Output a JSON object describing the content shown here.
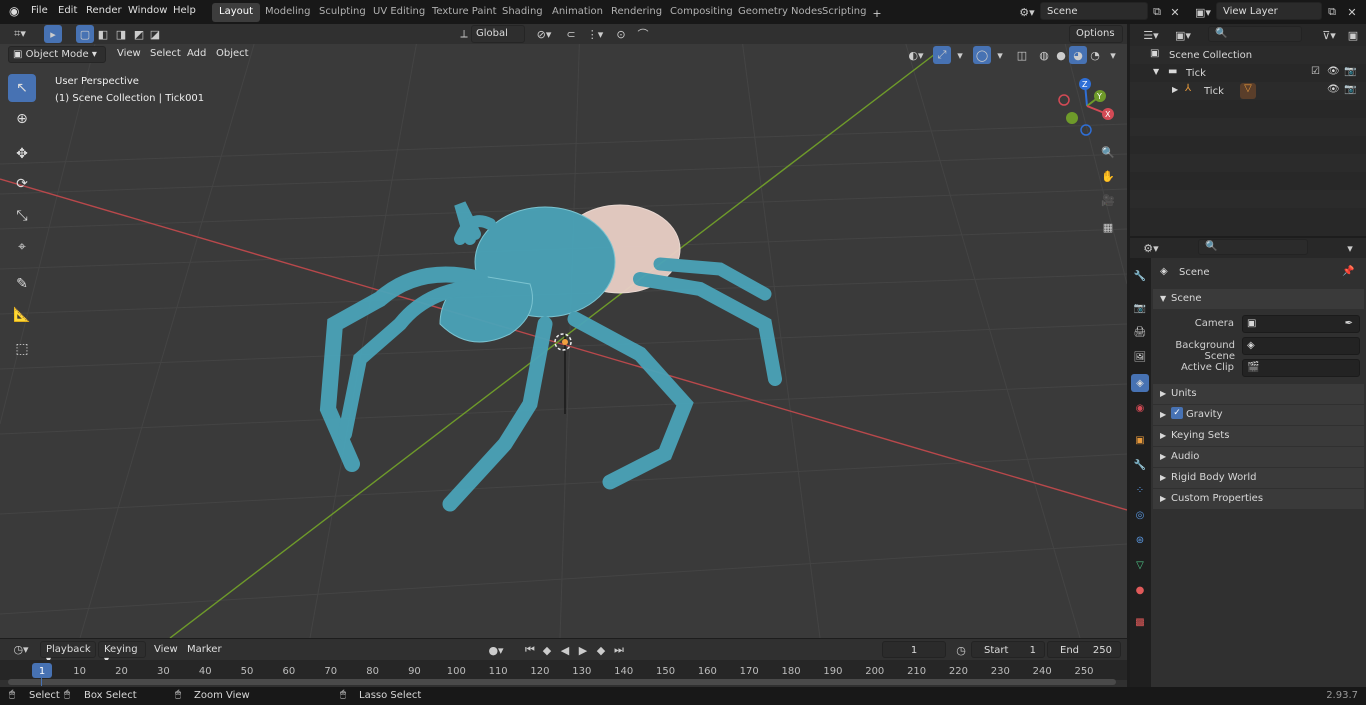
{
  "topbar": {
    "menus": [
      "File",
      "Edit",
      "Render",
      "Window",
      "Help"
    ],
    "workspace_tabs": [
      "Layout",
      "Modeling",
      "Sculpting",
      "UV Editing",
      "Texture Paint",
      "Shading",
      "Animation",
      "Rendering",
      "Compositing",
      "Geometry Nodes",
      "Scripting"
    ],
    "active_tab": "Layout",
    "scene_name": "Scene",
    "view_layer": "View Layer"
  },
  "viewport_header": {
    "mode": "Object Mode",
    "menus": [
      "View",
      "Select",
      "Add",
      "Object"
    ],
    "transform_orientation": "Global",
    "options_label": "Options"
  },
  "viewport": {
    "perspective_label": "User Perspective",
    "collection_label": "(1) Scene Collection | Tick001",
    "gizmo": {
      "x": "X",
      "y": "Y",
      "z": "Z"
    }
  },
  "outliner": {
    "root": "Scene Collection",
    "collection": "Tick",
    "object": "Tick"
  },
  "properties": {
    "header": "Scene",
    "panel": "Scene",
    "fields": [
      {
        "label": "Camera"
      },
      {
        "label": "Background Scene"
      },
      {
        "label": "Active Clip"
      }
    ],
    "panels": [
      "Units",
      "Gravity",
      "Keying Sets",
      "Audio",
      "Rigid Body World",
      "Custom Properties"
    ],
    "gravity_checked": true
  },
  "timeline": {
    "menus": [
      "Playback",
      "Keying",
      "View",
      "Marker"
    ],
    "current_frame": "1",
    "start_label": "Start",
    "start_value": "1",
    "end_label": "End",
    "end_value": "250",
    "ticks": [
      "1",
      "10",
      "20",
      "30",
      "40",
      "50",
      "60",
      "70",
      "80",
      "90",
      "100",
      "110",
      "120",
      "130",
      "140",
      "150",
      "160",
      "170",
      "180",
      "190",
      "200",
      "210",
      "220",
      "230",
      "240",
      "250"
    ]
  },
  "statusbar": {
    "select": "Select",
    "box_select": "Box Select",
    "zoom_view": "Zoom View",
    "lasso_select": "Lasso Select",
    "version": "2.93.7"
  },
  "colors": {
    "accent": "#4772b3",
    "x_axis": "#b8484b",
    "y_axis": "#6e9a2a",
    "tick_body": "#4aa3b8",
    "tick_abdomen": "#e9cfc6"
  }
}
